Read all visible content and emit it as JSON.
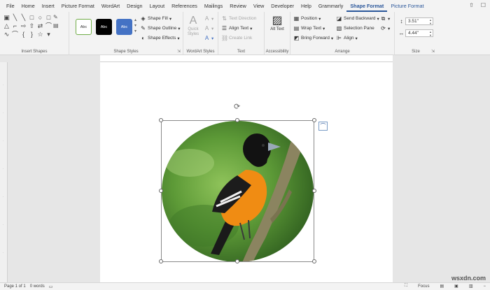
{
  "menu": {
    "tabs": [
      "File",
      "Home",
      "Insert",
      "Picture Format",
      "WordArt",
      "Design",
      "Layout",
      "References",
      "Mailings",
      "Review",
      "View",
      "Developer",
      "Help",
      "Grammarly",
      "Shape Format",
      "Picture Format"
    ],
    "active_tab": "Shape Format"
  },
  "ribbon": {
    "insert_shapes": {
      "label": "Insert Shapes"
    },
    "shape_styles": {
      "label": "Shape Styles",
      "swatch_text": "Abc",
      "fill": "Shape Fill",
      "outline": "Shape Outline",
      "effects": "Shape Effects"
    },
    "wordart": {
      "label": "WordArt Styles",
      "quick_styles": "Quick Styles"
    },
    "text": {
      "label": "Text",
      "direction": "Text Direction",
      "align": "Align Text",
      "link": "Create Link"
    },
    "accessibility": {
      "label": "Accessibility",
      "alt_text": "Alt Text"
    },
    "arrange": {
      "label": "Arrange",
      "position": "Position",
      "wrap": "Wrap Text",
      "bring_forward": "Bring Forward",
      "send_backward": "Send Backward",
      "selection_pane": "Selection Pane",
      "align": "Align"
    },
    "size": {
      "label": "Size",
      "height": "3.51\"",
      "width": "4.44\""
    }
  },
  "status": {
    "page": "Page 1 of 1",
    "words": "0 words",
    "focus": "Focus"
  },
  "watermark": "wsxdn.com",
  "colors": {
    "accent": "#2b579a",
    "swatch_blue": "#4472c4"
  }
}
